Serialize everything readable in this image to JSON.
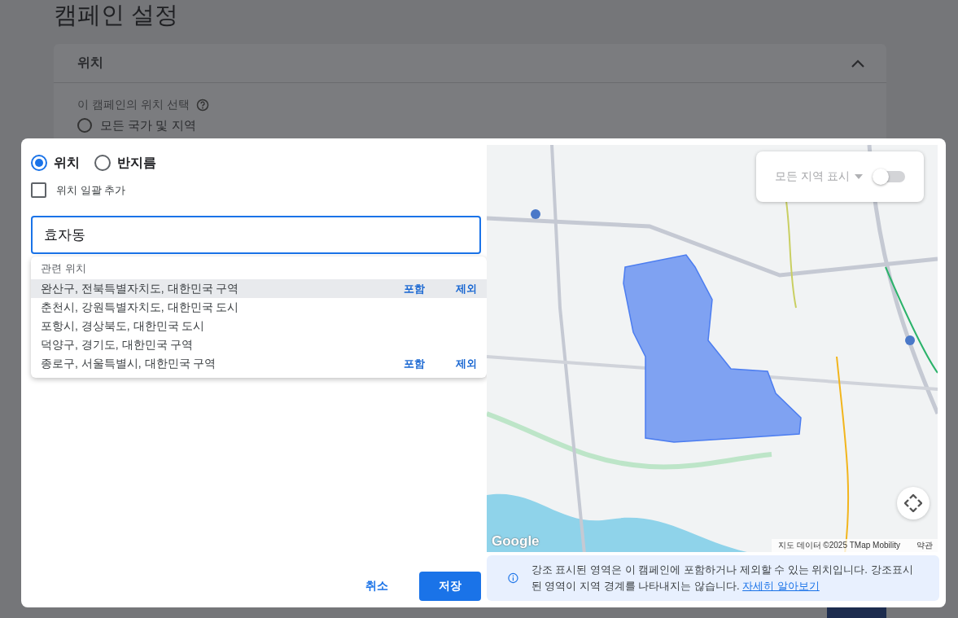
{
  "background": {
    "page_title": "캠페인 설정",
    "card_title": "위치",
    "expanded": true,
    "prompt": "이 캠페인의 위치 선택",
    "option": {
      "label": "모든 국가 및 지역",
      "selected": false
    }
  },
  "dialog": {
    "modes": [
      {
        "label": "위치",
        "selected": true
      },
      {
        "label": "반지름",
        "selected": false
      }
    ],
    "bulk_add": {
      "label": "위치 일괄 추가",
      "checked": false
    },
    "search": {
      "value": "효자동"
    },
    "suggestions": {
      "heading": "관련 위치",
      "items": [
        {
          "text": "완산구, 전북특별자치도, 대한민국 구역",
          "highlighted": true,
          "actions": [
            "포함",
            "제외"
          ]
        },
        {
          "text": "춘천시, 강원특별자치도, 대한민국 도시",
          "highlighted": false
        },
        {
          "text": "포항시, 경상북도, 대한민국 도시",
          "highlighted": false
        },
        {
          "text": "덕양구, 경기도, 대한민국 구역",
          "highlighted": false
        },
        {
          "text": "종로구, 서울특별시, 대한민국 구역",
          "highlighted": false,
          "actions": [
            "포함",
            "제외"
          ]
        }
      ]
    },
    "buttons": [
      {
        "label": "취소",
        "kind": "text"
      },
      {
        "label": "저장",
        "kind": "filled"
      }
    ]
  },
  "map": {
    "kind": "picture",
    "filter": {
      "label": "모든 지역 표시",
      "on": false
    },
    "logo": "Google",
    "attribution": "지도 데이터 ©2025 TMap Mobility",
    "terms": "약관"
  },
  "info": {
    "text": "강조 표시된 영역은 이 캠페인에 포함하거나 제외할 수 있는 위치입니다. 강조표시된 영역이 지역 경계를 나타내지는 않습니다. ",
    "link": "자세히 알아보기"
  }
}
